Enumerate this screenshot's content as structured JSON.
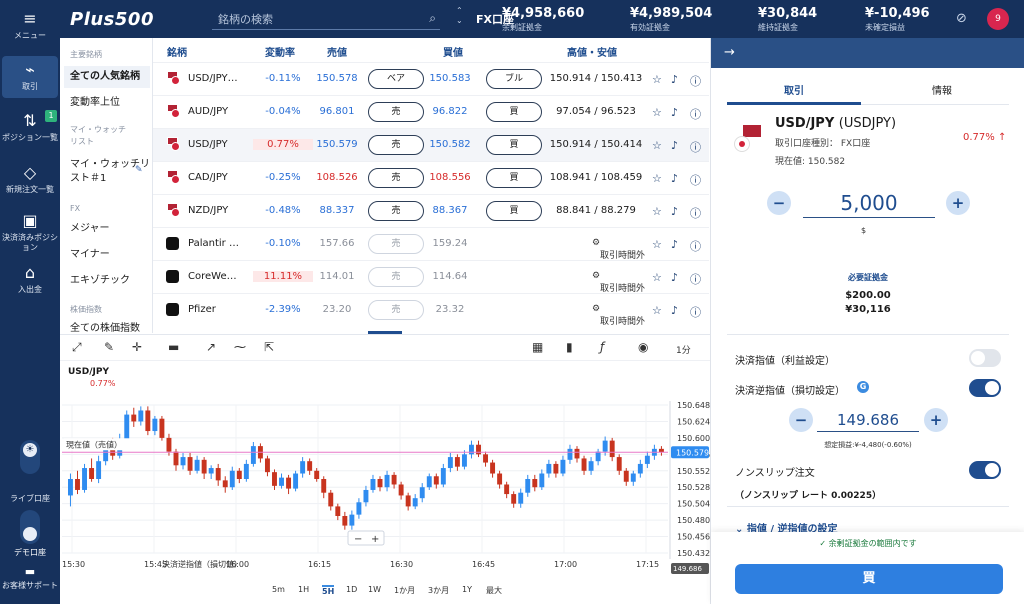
{
  "nav": {
    "items": [
      {
        "icon": "menu-icon",
        "glyph": "≡",
        "label": "メニュー"
      },
      {
        "icon": "chart-icon",
        "glyph": "📈",
        "label": "取引"
      },
      {
        "icon": "positions-icon",
        "glyph": "⇅",
        "label": "ポジション一覧",
        "badge": "1"
      },
      {
        "icon": "tag-icon",
        "glyph": "⌂",
        "label": "新規注文一覧"
      },
      {
        "icon": "briefcase-icon",
        "glyph": "▣",
        "label": "決済済みポジション"
      },
      {
        "icon": "bank-icon",
        "glyph": "⏛",
        "label": "入出金"
      }
    ],
    "live_label": "ライブ口座",
    "demo_label": "デモ口座",
    "support_label": "お客様サポート"
  },
  "header": {
    "logo": "Plus500",
    "search_placeholder": "銘柄の検索",
    "account_type": "FX口座",
    "stats": [
      {
        "value": "¥4,958,660",
        "label": "余剰証拠金"
      },
      {
        "value": "¥4,989,504",
        "label": "有効証拠金"
      },
      {
        "value": "¥30,844",
        "label": "維持証拠金"
      },
      {
        "value": "¥-10,496",
        "label": "未確定損益"
      }
    ],
    "notifications": "9"
  },
  "categories": {
    "h_main": "主要銘柄",
    "all_popular": "全ての人気銘柄",
    "top_movers": "変動率上位",
    "h_watch": "マイ・ウォッチリスト",
    "watchlist": "マイ・ウォッチリスト＃1",
    "h_fx": "FX",
    "majors": "メジャー",
    "minors": "マイナー",
    "exotics": "エキゾチック",
    "h_stocks": "株価指数",
    "all_indices": "全ての株価指数"
  },
  "table": {
    "headers": {
      "symbol": "銘柄",
      "change": "変動率",
      "sell": "売値",
      "buy": "買値",
      "hilo": "高値・安値"
    },
    "rows": [
      {
        "symbol": "USD/JPY…",
        "change": "-0.11%",
        "sell": "150.578",
        "sell_btn": "ベア",
        "buy": "150.583",
        "buy_btn": "ブル",
        "hilo": "150.914 / 150.413"
      },
      {
        "symbol": "AUD/JPY",
        "change": "-0.04%",
        "sell": "96.801",
        "sell_btn": "売",
        "buy": "96.822",
        "buy_btn": "買",
        "hilo": "97.054 / 96.523"
      },
      {
        "symbol": "USD/JPY",
        "change": "0.77%",
        "sell": "150.579",
        "sell_btn": "売",
        "buy": "150.582",
        "buy_btn": "買",
        "hilo": "150.914 / 150.414"
      },
      {
        "symbol": "CAD/JPY",
        "change": "-0.25%",
        "sell": "108.526",
        "sell_btn": "売",
        "buy": "108.556",
        "buy_btn": "買",
        "hilo": "108.941 / 108.459"
      },
      {
        "symbol": "NZD/JPY",
        "change": "-0.48%",
        "sell": "88.337",
        "sell_btn": "売",
        "buy": "88.367",
        "buy_btn": "買",
        "hilo": "88.841 / 88.279"
      },
      {
        "symbol": "Palantir …",
        "change": "-0.10%",
        "sell": "157.66",
        "sell_btn": "売",
        "buy": "159.24",
        "buy_btn": "",
        "hilo": "取引時間外"
      },
      {
        "symbol": "CoreWe…",
        "change": "11.11%",
        "sell": "114.01",
        "sell_btn": "売",
        "buy": "114.64",
        "buy_btn": "",
        "hilo": "取引時間外"
      },
      {
        "symbol": "Pfizer",
        "change": "-2.39%",
        "sell": "23.20",
        "sell_btn": "売",
        "buy": "23.32",
        "buy_btn": "",
        "hilo": "取引時間外"
      }
    ]
  },
  "chart": {
    "symbol": "USD/JPY",
    "change": "0.77%",
    "current_label": "現在値（売値）",
    "stop_label": "決済逆指値（損切値）",
    "last_price": "150.579",
    "stop_price": "149.686",
    "interval": "1分",
    "y_ticks": [
      "150.648",
      "150.624",
      "150.600",
      "150.576",
      "150.552",
      "150.528",
      "150.504",
      "150.480",
      "150.456",
      "150.432"
    ],
    "x_ticks": [
      "15:30",
      "15:45",
      "16:00",
      "16:15",
      "16:30",
      "16:45",
      "17:00",
      "17:15"
    ],
    "timeframes": [
      "5m",
      "1H",
      "5H",
      "1D",
      "1W",
      "1か月",
      "3か月",
      "1Y",
      "最大"
    ],
    "selected_tf": "5H",
    "zoom_minus": "−",
    "zoom_plus": "+"
  },
  "chart_data": {
    "type": "candlestick",
    "x": [
      "15:30",
      "17:20"
    ],
    "ylim": [
      150.432,
      150.648
    ],
    "candles": [
      [
        150.516,
        150.54,
        150.5,
        150.548
      ],
      [
        150.54,
        150.524,
        150.518,
        150.552
      ],
      [
        150.524,
        150.556,
        150.52,
        150.562
      ],
      [
        150.556,
        150.54,
        150.536,
        150.57
      ],
      [
        150.54,
        150.566,
        150.534,
        150.574
      ],
      [
        150.566,
        150.594,
        150.56,
        150.598
      ],
      [
        150.594,
        150.574,
        150.568,
        150.6
      ],
      [
        150.574,
        150.592,
        150.57,
        150.606
      ],
      [
        150.592,
        150.634,
        150.586,
        150.64
      ],
      [
        150.634,
        150.624,
        150.616,
        150.644
      ],
      [
        150.624,
        150.64,
        150.618,
        150.646
      ],
      [
        150.64,
        150.61,
        150.604,
        150.646
      ],
      [
        150.61,
        150.628,
        150.604,
        150.632
      ],
      [
        150.628,
        150.6,
        150.596,
        150.632
      ],
      [
        150.6,
        150.58,
        150.574,
        150.606
      ],
      [
        150.58,
        150.56,
        150.552,
        150.584
      ],
      [
        150.56,
        150.572,
        150.554,
        150.578
      ],
      [
        150.572,
        150.552,
        150.546,
        150.578
      ],
      [
        150.552,
        150.568,
        150.548,
        150.574
      ],
      [
        150.568,
        150.548,
        150.54,
        150.572
      ],
      [
        150.548,
        150.556,
        150.54,
        150.56
      ],
      [
        150.556,
        150.538,
        150.53,
        150.562
      ],
      [
        150.538,
        150.528,
        150.52,
        150.544
      ],
      [
        150.528,
        150.552,
        150.524,
        150.558
      ],
      [
        150.552,
        150.54,
        150.534,
        150.556
      ],
      [
        150.54,
        150.562,
        150.536,
        150.568
      ],
      [
        150.562,
        150.588,
        150.558,
        150.594
      ],
      [
        150.588,
        150.57,
        150.564,
        150.592
      ],
      [
        150.57,
        150.55,
        150.544,
        150.574
      ],
      [
        150.55,
        150.53,
        150.524,
        150.554
      ],
      [
        150.53,
        150.542,
        150.526,
        150.548
      ],
      [
        150.542,
        150.526,
        150.518,
        150.546
      ],
      [
        150.526,
        150.548,
        150.522,
        150.552
      ],
      [
        150.548,
        150.566,
        150.542,
        150.572
      ],
      [
        150.566,
        150.552,
        150.546,
        150.57
      ],
      [
        150.552,
        150.54,
        150.536,
        150.556
      ],
      [
        150.54,
        150.52,
        150.512,
        150.544
      ],
      [
        150.52,
        150.5,
        150.494,
        150.524
      ],
      [
        150.5,
        150.486,
        150.48,
        150.504
      ],
      [
        150.486,
        150.472,
        150.466,
        150.492
      ],
      [
        150.472,
        150.488,
        150.466,
        150.494
      ],
      [
        150.488,
        150.506,
        150.482,
        150.512
      ],
      [
        150.506,
        150.524,
        150.5,
        150.53
      ],
      [
        150.524,
        150.54,
        150.52,
        150.546
      ],
      [
        150.54,
        150.528,
        150.522,
        150.544
      ],
      [
        150.528,
        150.546,
        150.522,
        150.552
      ],
      [
        150.546,
        150.532,
        150.526,
        150.55
      ],
      [
        150.532,
        150.516,
        150.51,
        150.536
      ],
      [
        150.516,
        150.5,
        150.494,
        150.52
      ],
      [
        150.5,
        150.512,
        150.496,
        150.518
      ],
      [
        150.512,
        150.528,
        150.506,
        150.534
      ],
      [
        150.528,
        150.544,
        150.524,
        150.548
      ],
      [
        150.544,
        150.532,
        150.526,
        150.548
      ],
      [
        150.532,
        150.556,
        150.528,
        150.562
      ],
      [
        150.556,
        150.572,
        150.55,
        150.578
      ],
      [
        150.572,
        150.558,
        150.552,
        150.576
      ],
      [
        150.558,
        150.576,
        150.554,
        150.582
      ],
      [
        150.576,
        150.59,
        150.57,
        150.596
      ],
      [
        150.59,
        150.576,
        150.572,
        150.596
      ],
      [
        150.576,
        150.564,
        150.558,
        150.58
      ],
      [
        150.564,
        150.548,
        150.542,
        150.568
      ],
      [
        150.548,
        150.532,
        150.526,
        150.552
      ],
      [
        150.532,
        150.518,
        150.512,
        150.536
      ],
      [
        150.518,
        150.504,
        150.498,
        150.522
      ],
      [
        150.504,
        150.52,
        150.498,
        150.526
      ],
      [
        150.52,
        150.54,
        150.514,
        150.546
      ],
      [
        150.54,
        150.528,
        150.522,
        150.546
      ],
      [
        150.528,
        150.548,
        150.524,
        150.554
      ],
      [
        150.548,
        150.562,
        150.542,
        150.568
      ],
      [
        150.562,
        150.548,
        150.542,
        150.566
      ],
      [
        150.548,
        150.568,
        150.544,
        150.574
      ],
      [
        150.568,
        150.584,
        150.562,
        150.59
      ],
      [
        150.584,
        150.57,
        150.564,
        150.588
      ],
      [
        150.57,
        150.552,
        150.546,
        150.574
      ],
      [
        150.552,
        150.566,
        150.546,
        150.572
      ],
      [
        150.566,
        150.58,
        150.56,
        150.584
      ],
      [
        150.58,
        150.596,
        150.574,
        150.602
      ],
      [
        150.596,
        150.572,
        150.566,
        150.6
      ],
      [
        150.572,
        150.552,
        150.546,
        150.576
      ],
      [
        150.552,
        150.536,
        150.53,
        150.556
      ],
      [
        150.536,
        150.548,
        150.53,
        150.552
      ],
      [
        150.548,
        150.562,
        150.542,
        150.568
      ],
      [
        150.562,
        150.574,
        150.556,
        150.58
      ],
      [
        150.574,
        150.584,
        150.568,
        150.59
      ],
      [
        150.584,
        150.579,
        150.574,
        150.588
      ]
    ]
  },
  "panel": {
    "tab_trade": "取引",
    "tab_info": "情報",
    "symbol": "USD/JPY",
    "code": "(USDJPY)",
    "account_label": "取引口座種別： FX口座",
    "current_price": "現在値: 150.582",
    "change": "0.77% ↑",
    "amount": "5,000",
    "unit": "$",
    "margin_label": "必要証拠金",
    "margin_usd": "$200.00",
    "margin_jpy": "¥30,116",
    "tp_label": "決済指値（利益設定）",
    "sl_label": "決済逆指値（損切設定）",
    "stop_value": "149.686",
    "stop_loss_estimate": "想定損益:¥-4,480(-0.60%)",
    "nonslip_label": "ノンスリップ注文",
    "nonslip_rate": "（ノンスリップ レート 0.00225）",
    "advanced": "指値 / 逆指値の設定",
    "margin_ok": "余剰証拠金の範囲内です",
    "buy_label": "買",
    "colors": {
      "buy": "#2e7fe0",
      "sell_blue": "#2a6fd6",
      "loss": "#d62b2b",
      "brand": "#16315c"
    }
  }
}
